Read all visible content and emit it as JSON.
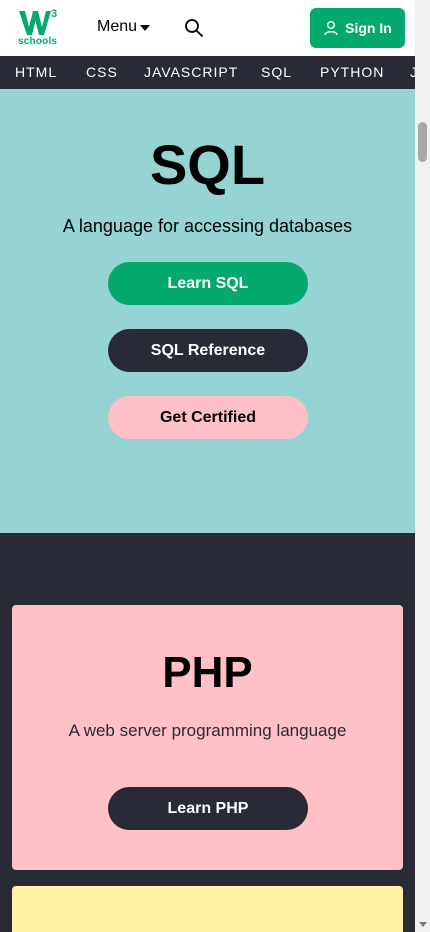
{
  "header": {
    "logo_text": "schools",
    "menu_label": "Menu",
    "signin_label": "Sign In"
  },
  "nav": {
    "items": [
      "HTML",
      "CSS",
      "JAVASCRIPT",
      "SQL",
      "PYTHON",
      "J"
    ]
  },
  "sql_hero": {
    "title": "SQL",
    "subtitle": "A language for accessing databases",
    "learn_label": "Learn SQL",
    "reference_label": "SQL Reference",
    "certified_label": "Get Certified"
  },
  "php_card": {
    "title": "PHP",
    "subtitle": "A web server programming language",
    "learn_label": "Learn PHP"
  },
  "colors": {
    "brand_green": "#04aa6d",
    "dark": "#282a35",
    "sql_bg": "#96d4d4",
    "pink": "#ffc0c7",
    "yellow": "#fff4a3"
  }
}
